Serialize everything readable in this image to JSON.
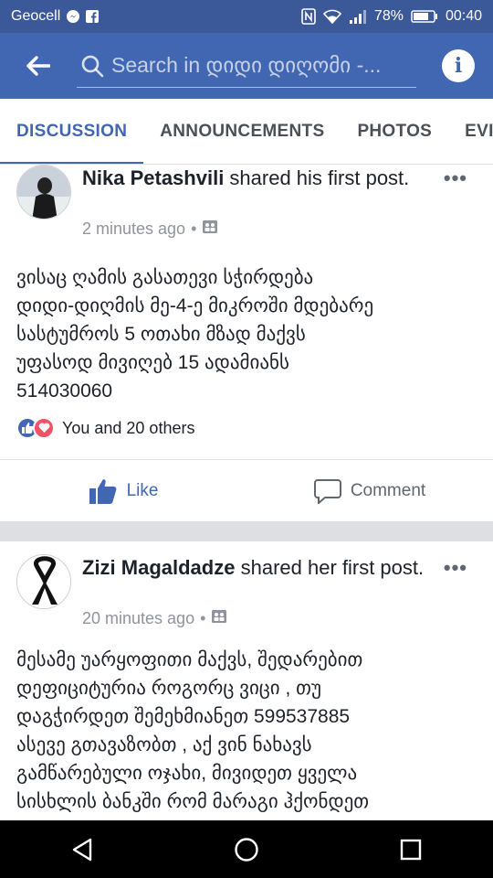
{
  "status_bar": {
    "carrier": "Geocell",
    "battery": "78%",
    "time": "00:40"
  },
  "app_bar": {
    "search_placeholder": "Search in დიდი დიღომი -..."
  },
  "tabs": [
    {
      "label": "DISCUSSION",
      "active": true
    },
    {
      "label": "ANNOUNCEMENTS",
      "active": false
    },
    {
      "label": "PHOTOS",
      "active": false
    },
    {
      "label": "EVI",
      "active": false
    }
  ],
  "posts": [
    {
      "author": "Nika Petashvili",
      "action": " shared his first post.",
      "time": "2 minutes ago",
      "text": "ვისაც ღამის გასათევი სჭირდება\nდიდი-დიღმის მე-4-ე მიკროში მდებარე\nსასტუმროს 5 ოთახი მზად მაქვს\nუფასოდ მივიღებ 15 ადამიანს\n514030060",
      "reactions": "You and 20 others",
      "like_label": "Like",
      "comment_label": "Comment"
    },
    {
      "author": "Zizi Magaldadze",
      "action": " shared her first post.",
      "time": "20 minutes ago",
      "text": "მესამე უარყოფითი მაქვს, შედარებით\nდეფიციტურია როგორც ვიცი , თუ\nდაგჭირდეთ შემეხმიანეთ 599537885\nასევე გთავაზობთ , აქ ვინ ნახავს\nგამწარებული ოჯახი, მივიდეთ ყველა\nსისხლის ბანკში რომ მარაგი ჰქონდეთ"
    }
  ],
  "colors": {
    "brand": "#4267b2",
    "status_bar": "#3b5998",
    "like_blue": "#4267b2",
    "love_red": "#f25268"
  }
}
